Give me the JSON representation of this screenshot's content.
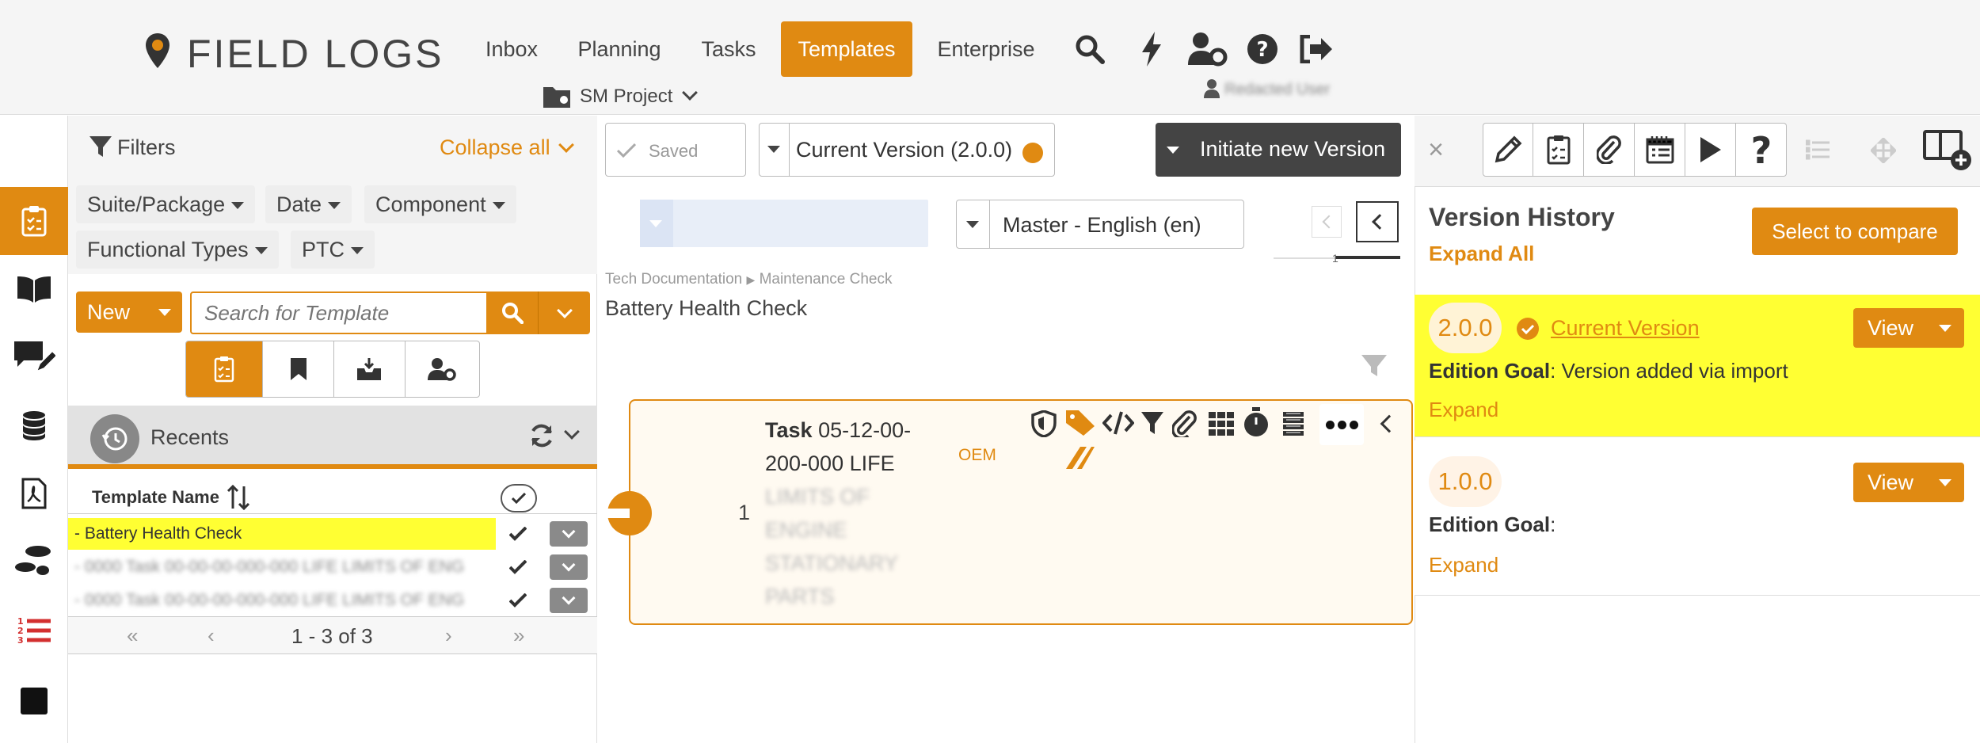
{
  "brand": {
    "name": "FIELD LOGS"
  },
  "nav": {
    "inbox": "Inbox",
    "planning": "Planning",
    "tasks": "Tasks",
    "templates": "Templates",
    "enterprise": "Enterprise"
  },
  "project": {
    "label": "SM Project"
  },
  "user": {
    "name": "Redacted User"
  },
  "filters": {
    "title": "Filters",
    "collapse": "Collapse all",
    "chips": [
      "Suite/Package",
      "Date",
      "Component",
      "Functional Types",
      "PTC"
    ]
  },
  "search": {
    "new_label": "New",
    "placeholder": "Search for Template"
  },
  "recents": {
    "title": "Recents",
    "col_name": "Template Name",
    "rows": [
      "- Battery Health Check",
      "- 0000 Task 00-00-00-000-000 LIFE LIMITS OF ENG",
      "- 0000 Task 00-00-00-000-000 LIFE LIMITS OF ENG"
    ],
    "pager": "1 - 3 of 3"
  },
  "editor": {
    "saved": "Saved",
    "version": "Current Version (2.0.0)",
    "initiate": "Initiate new Version",
    "language": "Master - English (en)",
    "pager_num": "1",
    "breadcrumb": [
      "Tech Documentation",
      "Maintenance Check"
    ],
    "title": "Battery Health Check"
  },
  "task": {
    "number": "1",
    "label": "Task",
    "code": "05-12-00-200-000 LIFE",
    "blurred": "LIMITS OF ENGINE STATIONARY PARTS",
    "oem": "OEM"
  },
  "history": {
    "title": "Version History",
    "expand_all": "Expand All",
    "compare": "Select to compare",
    "versions": [
      {
        "version": "2.0.0",
        "current": "Current Version",
        "goal_label": "Edition Goal",
        "goal_value": ": Version added via import",
        "expand": "Expand",
        "view": "View"
      },
      {
        "version": "1.0.0",
        "goal_label": "Edition Goal",
        "goal_value": ":",
        "expand": "Expand",
        "view": "View"
      }
    ]
  },
  "colors": {
    "accent": "#e08a12",
    "highlight": "#ffff33",
    "dark": "#444444"
  },
  "icons": [
    "map-pin-icon",
    "search-icon",
    "bolt-icon",
    "user-gear-icon",
    "help-icon",
    "logout-icon",
    "folder-gear-icon",
    "user-icon",
    "filter-icon",
    "clipboard-icon",
    "book-icon",
    "chat-edit-icon",
    "database-icon",
    "pdf-icon",
    "footsteps-icon",
    "numbered-list-icon",
    "square-icon",
    "bookmark-icon",
    "inbox-download-icon",
    "history-icon",
    "refresh-icon",
    "sort-icon",
    "pencil-icon",
    "paperclip-icon",
    "play-icon",
    "move-icon",
    "layout-add-icon",
    "shield-icon",
    "tag-icon",
    "code-icon",
    "grid-icon",
    "stopwatch-icon",
    "coins-icon",
    "more-icon",
    "chevron-left-icon",
    "check-circle-icon"
  ]
}
